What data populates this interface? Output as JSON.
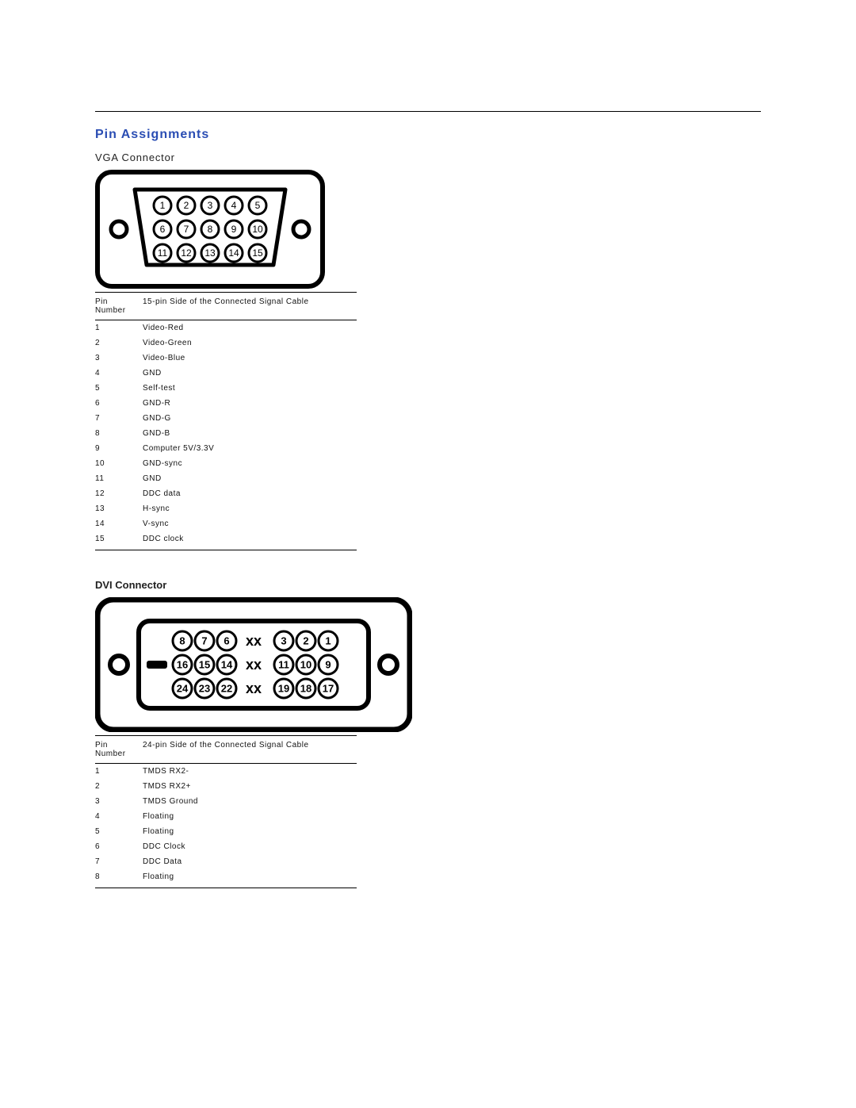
{
  "section_title": "Pin Assignments",
  "vga": {
    "title": "VGA Connector",
    "table_header": {
      "pin": "Pin Number",
      "desc": "15-pin Side of the Connected Signal Cable"
    },
    "pins": [
      {
        "n": "1",
        "d": "Video-Red"
      },
      {
        "n": "2",
        "d": "Video-Green"
      },
      {
        "n": "3",
        "d": "Video-Blue"
      },
      {
        "n": "4",
        "d": "GND"
      },
      {
        "n": "5",
        "d": "Self-test"
      },
      {
        "n": "6",
        "d": "GND-R"
      },
      {
        "n": "7",
        "d": "GND-G"
      },
      {
        "n": "8",
        "d": "GND-B"
      },
      {
        "n": "9",
        "d": "Computer 5V/3.3V"
      },
      {
        "n": "10",
        "d": "GND-sync"
      },
      {
        "n": "11",
        "d": "GND"
      },
      {
        "n": "12",
        "d": "DDC data"
      },
      {
        "n": "13",
        "d": "H-sync"
      },
      {
        "n": "14",
        "d": "V-sync"
      },
      {
        "n": "15",
        "d": "DDC clock"
      }
    ]
  },
  "dvi": {
    "title": "DVI Connector",
    "table_header": {
      "pin": "Pin Number",
      "desc": "24-pin Side of the Connected Signal Cable"
    },
    "pins": [
      {
        "n": "1",
        "d": "TMDS RX2-"
      },
      {
        "n": "2",
        "d": "TMDS RX2+"
      },
      {
        "n": "3",
        "d": "TMDS Ground"
      },
      {
        "n": "4",
        "d": "Floating"
      },
      {
        "n": "5",
        "d": "Floating"
      },
      {
        "n": "6",
        "d": "DDC Clock"
      },
      {
        "n": "7",
        "d": "DDC Data"
      },
      {
        "n": "8",
        "d": "Floating"
      }
    ]
  }
}
